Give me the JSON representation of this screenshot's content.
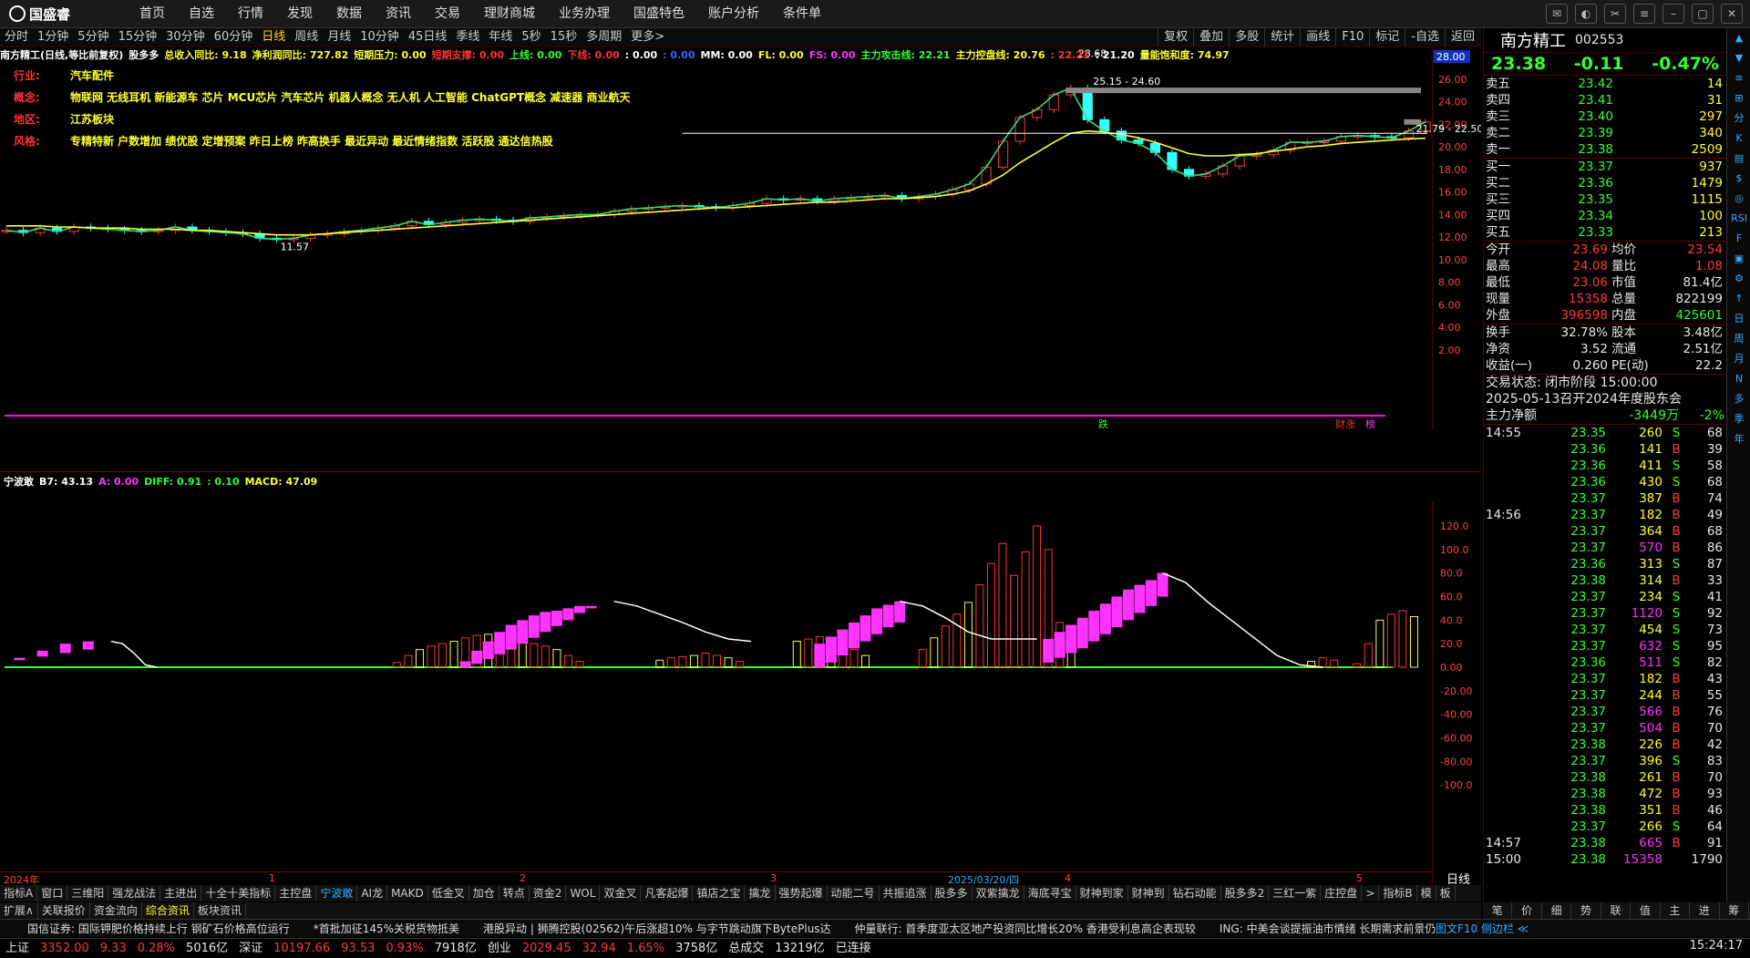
{
  "app": {
    "logo": "国盛睿"
  },
  "menu": [
    "首页",
    "自选",
    "行情",
    "发现",
    "数据",
    "资讯",
    "交易",
    "理财商城",
    "业务办理",
    "国盛特色",
    "账户分析",
    "条件单"
  ],
  "periods": [
    "分时",
    "1分钟",
    "5分钟",
    "15分钟",
    "30分钟",
    "60分钟",
    "日线",
    "周线",
    "月线",
    "10分钟",
    "45日线",
    "季线",
    "年线",
    "5秒",
    "15秒",
    "多周期",
    "更多>"
  ],
  "period_selected": "日线",
  "tools": [
    "复权",
    "叠加",
    "多股",
    "统计",
    "画线",
    "F10",
    "标记",
    "-自选",
    "返回"
  ],
  "indicator_line": [
    {
      "t": "南方精工(日线,等比前复权)",
      "c": "#ffffff"
    },
    {
      "t": "股多多",
      "c": "#ffffff"
    },
    {
      "t": "总收入同比: 9.18",
      "c": "#ffff33"
    },
    {
      "t": "净利润同比: 727.82",
      "c": "#ffff33"
    },
    {
      "t": "短期压力: 0.00",
      "c": "#ffff33"
    },
    {
      "t": "短期支撑: 0.00",
      "c": "#ff3333"
    },
    {
      "t": "上线: 0.00",
      "c": "#33ff33"
    },
    {
      "t": "下线: 0.00",
      "c": "#ff3333"
    },
    {
      "t": ": 0.00",
      "c": "#ffffff"
    },
    {
      "t": ": 0.00",
      "c": "#3366ff"
    },
    {
      "t": "MM: 0.00",
      "c": "#ffffff"
    },
    {
      "t": "FL: 0.00",
      "c": "#ffff33"
    },
    {
      "t": "FS: 0.00",
      "c": "#ff33ff"
    },
    {
      "t": "主力攻击线: 22.21",
      "c": "#33ff33"
    },
    {
      "t": "主力控盘线: 20.76",
      "c": "#ffff33"
    },
    {
      "t": ": 22.21",
      "c": "#ff3333"
    },
    {
      "t": ": 21.20",
      "c": "#ffffff"
    },
    {
      "t": "量能饱和度: 74.97",
      "c": "#ffff33"
    }
  ],
  "tags": [
    {
      "k": "行业:",
      "v": "汽车配件"
    },
    {
      "k": "概念:",
      "v": "物联网 无线耳机 新能源车 芯片 MCU芯片 汽车芯片 机器人概念 无人机 人工智能 ChatGPT概念 减速器 商业航天"
    },
    {
      "k": "地区:",
      "v": "江苏板块"
    },
    {
      "k": "风格:",
      "v": "专精特新 户数增加 绩优股 定增预案 昨日上榜 昨高换手 最近异动 最近情绪指数 活跃股 通达信热股"
    }
  ],
  "chart_labels": {
    "high": "28.68",
    "low": "11.57",
    "range1": "25.15 - 24.60",
    "range2": "21.79 - 22.50",
    "axis_tag": "28.00",
    "fall": "跌",
    "cai": "财涨",
    "bang": "榜"
  },
  "chart_data": [
    {
      "type": "line",
      "title": "南方精工(日线,等比前复权)",
      "xlabel": "",
      "ylabel": "",
      "ylim": [
        2,
        28
      ],
      "yticks": [
        "26.00",
        "24.00",
        "22.00",
        "20.00",
        "18.00",
        "16.00",
        "14.00",
        "12.00",
        "10.00",
        "8.00",
        "6.00",
        "4.00",
        "2.00"
      ],
      "xticks": [
        "2024年",
        "1",
        "2",
        "3",
        "2025/03/20/四",
        "4",
        "5"
      ],
      "series": [
        {
          "name": "主力攻击线",
          "values": [
            12.6,
            12.4,
            12.8,
            12.5,
            12.9,
            12.8,
            12.7,
            12.6,
            12.5,
            12.6,
            12.9,
            12.6,
            12.5,
            12.4,
            12.3,
            11.9,
            11.8,
            11.9,
            12.2,
            12.3,
            12.5,
            12.6,
            12.8,
            13.0,
            13.4,
            13.1,
            13.3,
            13.5,
            13.6,
            13.5,
            13.4,
            13.7,
            13.8,
            13.9,
            14.0,
            14.0,
            14.3,
            14.5,
            14.6,
            14.7,
            14.8,
            14.7,
            14.6,
            14.8,
            15.0,
            15.4,
            15.3,
            15.4,
            15.2,
            15.4,
            15.5,
            15.6,
            15.7,
            15.4,
            15.6,
            15.8,
            16.2,
            16.7,
            18.2,
            20.5,
            22.6,
            23.3,
            24.6,
            25.2,
            22.4,
            21.4,
            20.6,
            20.3,
            19.5,
            18.0,
            17.4,
            17.6,
            18.3,
            19.2,
            19.3,
            19.7,
            20.4,
            20.4,
            20.5,
            20.9,
            21.0,
            20.9,
            20.8,
            21.4,
            22.2
          ]
        },
        {
          "name": "主力控盘线",
          "values": [
            13.0,
            13.0,
            13.0,
            12.9,
            12.9,
            12.8,
            12.8,
            12.8,
            12.7,
            12.7,
            12.7,
            12.6,
            12.6,
            12.5,
            12.4,
            12.3,
            12.2,
            12.2,
            12.2,
            12.3,
            12.4,
            12.5,
            12.6,
            12.7,
            12.8,
            12.9,
            13.0,
            13.1,
            13.2,
            13.3,
            13.4,
            13.5,
            13.6,
            13.7,
            13.8,
            13.9,
            14.0,
            14.1,
            14.2,
            14.3,
            14.4,
            14.5,
            14.6,
            14.6,
            14.7,
            14.8,
            14.9,
            15.0,
            15.1,
            15.1,
            15.2,
            15.3,
            15.4,
            15.4,
            15.5,
            15.6,
            15.8,
            16.1,
            16.7,
            17.5,
            18.6,
            19.5,
            20.4,
            21.2,
            21.4,
            21.3,
            21.1,
            20.8,
            20.4,
            19.9,
            19.4,
            19.2,
            19.2,
            19.3,
            19.4,
            19.6,
            19.8,
            20.0,
            20.1,
            20.3,
            20.4,
            20.5,
            20.6,
            20.7,
            20.76
          ]
        }
      ]
    },
    {
      "type": "bar",
      "title": "宁波敢",
      "legend": [
        {
          "t": "B7: 43.13",
          "c": "#ffffff"
        },
        {
          "t": "A: 0.00",
          "c": "#ff33ff"
        },
        {
          "t": "DIFF: 0.91",
          "c": "#33ff33"
        },
        {
          "t": ": 0.10",
          "c": "#33ff33"
        },
        {
          "t": "MACD: 47.09",
          "c": "#ffff33"
        }
      ],
      "ylim": [
        -120,
        120
      ],
      "yticks": [
        "120.0",
        "100.0",
        "80.0",
        "60.0",
        "40.0",
        "20.0",
        "0.00",
        "-20.00",
        "-40.00",
        "-60.00",
        "-80.00",
        "-100.0"
      ],
      "values": [
        0,
        0,
        0,
        0,
        0,
        0,
        0,
        0,
        0,
        0,
        0,
        0,
        0,
        0,
        0,
        0,
        0,
        0,
        0,
        0,
        0,
        0,
        0,
        0,
        0,
        0,
        0,
        0,
        0,
        0,
        0,
        0,
        0,
        0,
        0,
        0,
        0,
        0,
        0,
        0,
        0,
        0,
        0,
        0,
        0,
        0,
        0,
        0,
        0,
        0,
        0,
        0,
        0,
        0,
        0,
        0,
        0,
        0,
        0,
        0,
        0,
        0,
        0,
        0,
        0,
        0,
        0,
        0,
        0,
        0,
        0,
        0,
        0,
        0,
        0,
        0,
        0,
        0,
        0,
        0,
        0,
        0,
        0,
        0,
        0
      ],
      "bars": [
        {
          "i": 34,
          "v": 4
        },
        {
          "i": 35,
          "v": 10
        },
        {
          "i": 36,
          "v": 15
        },
        {
          "i": 37,
          "v": 18
        },
        {
          "i": 38,
          "v": 20
        },
        {
          "i": 39,
          "v": 22
        },
        {
          "i": 40,
          "v": 25
        },
        {
          "i": 41,
          "v": 27
        },
        {
          "i": 42,
          "v": 28
        },
        {
          "i": 43,
          "v": 29
        },
        {
          "i": 44,
          "v": 28
        },
        {
          "i": 45,
          "v": 24
        },
        {
          "i": 46,
          "v": 20
        },
        {
          "i": 47,
          "v": 18
        },
        {
          "i": 48,
          "v": 15
        },
        {
          "i": 49,
          "v": 10
        },
        {
          "i": 50,
          "v": 5
        },
        {
          "i": 57,
          "v": 6
        },
        {
          "i": 58,
          "v": 8
        },
        {
          "i": 59,
          "v": 9
        },
        {
          "i": 60,
          "v": 10
        },
        {
          "i": 61,
          "v": 12
        },
        {
          "i": 62,
          "v": 10
        },
        {
          "i": 63,
          "v": 8
        },
        {
          "i": 64,
          "v": 5
        },
        {
          "i": 69,
          "v": 22
        },
        {
          "i": 70,
          "v": 24
        },
        {
          "i": 71,
          "v": 26
        },
        {
          "i": 72,
          "v": 25
        },
        {
          "i": 73,
          "v": 20
        },
        {
          "i": 74,
          "v": 15
        },
        {
          "i": 75,
          "v": 10
        },
        {
          "i": 80,
          "v": 15
        },
        {
          "i": 81,
          "v": 25
        },
        {
          "i": 82,
          "v": 35
        },
        {
          "i": 83,
          "v": 45
        },
        {
          "i": 84,
          "v": 55
        },
        {
          "i": 85,
          "v": 70
        },
        {
          "i": 86,
          "v": 88
        },
        {
          "i": 87,
          "v": 105
        },
        {
          "i": 88,
          "v": 78
        },
        {
          "i": 89,
          "v": 98
        },
        {
          "i": 90,
          "v": 120
        },
        {
          "i": 91,
          "v": 100
        },
        {
          "i": 92,
          "v": 38
        },
        {
          "i": 93,
          "v": 15
        },
        {
          "i": 114,
          "v": 5
        },
        {
          "i": 115,
          "v": 8
        },
        {
          "i": 116,
          "v": 6
        },
        {
          "i": 118,
          "v": 3
        },
        {
          "i": 119,
          "v": 20
        },
        {
          "i": 120,
          "v": 40
        },
        {
          "i": 121,
          "v": 45
        },
        {
          "i": 122,
          "v": 48
        },
        {
          "i": 123,
          "v": 43
        }
      ]
    }
  ],
  "quote": {
    "name": "南方精工",
    "code": "002553",
    "price": "23.38",
    "change": "-0.11",
    "pct": "-0.47%",
    "asks": [
      {
        "l": "卖五",
        "p": "23.42",
        "v": "14"
      },
      {
        "l": "卖四",
        "p": "23.41",
        "v": "31"
      },
      {
        "l": "卖三",
        "p": "23.40",
        "v": "297"
      },
      {
        "l": "卖二",
        "p": "23.39",
        "v": "340"
      },
      {
        "l": "卖一",
        "p": "23.38",
        "v": "2509"
      }
    ],
    "bids": [
      {
        "l": "买一",
        "p": "23.37",
        "v": "937"
      },
      {
        "l": "买二",
        "p": "23.36",
        "v": "1479"
      },
      {
        "l": "买三",
        "p": "23.35",
        "v": "1115"
      },
      {
        "l": "买四",
        "p": "23.34",
        "v": "100"
      },
      {
        "l": "买五",
        "p": "23.33",
        "v": "213"
      }
    ],
    "stats": [
      {
        "l1": "今开",
        "v1": "23.69",
        "c1": "red",
        "l2": "均价",
        "v2": "23.54",
        "c2": "red"
      },
      {
        "l1": "最高",
        "v1": "24.08",
        "c1": "red",
        "l2": "量比",
        "v2": "1.08",
        "c2": "red"
      },
      {
        "l1": "最低",
        "v1": "23.06",
        "c1": "red",
        "l2": "市值",
        "v2": "81.4亿",
        "c2": "wht"
      },
      {
        "l1": "现量",
        "v1": "15358",
        "c1": "red",
        "l2": "总量",
        "v2": "822199",
        "c2": "wht"
      },
      {
        "l1": "外盘",
        "v1": "396598",
        "c1": "red",
        "l2": "内盘",
        "v2": "425601",
        "c2": "grn"
      }
    ],
    "stats2": [
      {
        "l1": "换手",
        "v1": "32.78%",
        "l2": "股本",
        "v2": "3.48亿"
      },
      {
        "l1": "净资",
        "v1": "3.52",
        "l2": "流通",
        "v2": "2.51亿"
      },
      {
        "l1": "收益(一)",
        "v1": "0.260",
        "l2": "PE(动)",
        "v2": "22.2"
      }
    ],
    "trade_state": "交易状态: 闭市阶段 15:00:00",
    "notice": "2025-05-13召开2024年度股东会",
    "netflow_label": "主力净额",
    "netflow_val": "-3449万",
    "netflow_pct": "-2%"
  },
  "ticks": [
    {
      "t": "14:55",
      "p": "23.35",
      "v": "260",
      "s": "S",
      "n": "68"
    },
    {
      "t": "",
      "p": "23.36",
      "v": "141",
      "s": "B",
      "n": "39"
    },
    {
      "t": "",
      "p": "23.36",
      "v": "411",
      "s": "S",
      "n": "58"
    },
    {
      "t": "",
      "p": "23.36",
      "v": "430",
      "s": "S",
      "n": "68"
    },
    {
      "t": "",
      "p": "23.37",
      "v": "387",
      "s": "B",
      "n": "74"
    },
    {
      "t": "14:56",
      "p": "23.37",
      "v": "182",
      "s": "B",
      "n": "49"
    },
    {
      "t": "",
      "p": "23.37",
      "v": "364",
      "s": "B",
      "n": "68"
    },
    {
      "t": "",
      "p": "23.37",
      "v": "570",
      "s": "B",
      "n": "86"
    },
    {
      "t": "",
      "p": "23.36",
      "v": "313",
      "s": "S",
      "n": "87"
    },
    {
      "t": "",
      "p": "23.38",
      "v": "314",
      "s": "B",
      "n": "33"
    },
    {
      "t": "",
      "p": "23.37",
      "v": "234",
      "s": "S",
      "n": "41"
    },
    {
      "t": "",
      "p": "23.37",
      "v": "1120",
      "s": "S",
      "n": "92"
    },
    {
      "t": "",
      "p": "23.37",
      "v": "454",
      "s": "S",
      "n": "73"
    },
    {
      "t": "",
      "p": "23.37",
      "v": "632",
      "s": "S",
      "n": "95"
    },
    {
      "t": "",
      "p": "23.36",
      "v": "511",
      "s": "S",
      "n": "82"
    },
    {
      "t": "",
      "p": "23.37",
      "v": "182",
      "s": "B",
      "n": "43"
    },
    {
      "t": "",
      "p": "23.37",
      "v": "244",
      "s": "B",
      "n": "55"
    },
    {
      "t": "",
      "p": "23.37",
      "v": "566",
      "s": "B",
      "n": "76"
    },
    {
      "t": "",
      "p": "23.37",
      "v": "504",
      "s": "B",
      "n": "70"
    },
    {
      "t": "",
      "p": "23.38",
      "v": "226",
      "s": "B",
      "n": "42"
    },
    {
      "t": "",
      "p": "23.37",
      "v": "396",
      "s": "S",
      "n": "83"
    },
    {
      "t": "",
      "p": "23.38",
      "v": "261",
      "s": "B",
      "n": "70"
    },
    {
      "t": "",
      "p": "23.38",
      "v": "472",
      "s": "B",
      "n": "93"
    },
    {
      "t": "",
      "p": "23.38",
      "v": "351",
      "s": "B",
      "n": "46"
    },
    {
      "t": "",
      "p": "23.37",
      "v": "266",
      "s": "S",
      "n": "64"
    },
    {
      "t": "14:57",
      "p": "23.38",
      "v": "665",
      "s": "B",
      "n": "91"
    },
    {
      "t": "15:00",
      "p": "23.38",
      "v": "15358",
      "s": "",
      "n": "1790"
    }
  ],
  "sidebar": [
    "▲",
    "▼",
    "≡",
    "⊞",
    "分",
    "K",
    "▤",
    "$",
    "◎",
    "RSI",
    "F",
    "▣",
    "⚙",
    "↑",
    "日",
    "周",
    "月",
    "N",
    "多",
    "季",
    "年"
  ],
  "tabs1": [
    "指标A",
    "窗口",
    "三维阳",
    "强龙战法",
    "主进出",
    "十全十美指标",
    "主控盘",
    "宁波敢",
    "AI龙",
    "MAKD",
    "低金叉",
    "加仓",
    "转点",
    "资金2",
    "WOL",
    "双金叉",
    "凡客起爆",
    "镇店之宝",
    "擒龙",
    "强势起爆",
    "动能二号",
    "共振追涨",
    "股多多",
    "双紫擒龙",
    "海底寻宝",
    "财神到家",
    "财神到",
    "钻石动能",
    "股多多2",
    "三红一紫",
    "庄控盘",
    ">",
    "指标B",
    "模",
    "板"
  ],
  "tab1_selected": "宁波敢",
  "tabs2": [
    "扩展∧",
    "关联报价",
    "资金流向",
    "综合资讯",
    "板块资讯"
  ],
  "tab2_selected": "综合资讯",
  "rtabs": [
    "笔",
    "价",
    "细",
    "势",
    "联",
    "值",
    "主",
    "进",
    "筹"
  ],
  "news": [
    "国信证券: 国际钾肥价格持续上行  钢矿石价格高位运行",
    "*首批加征145%关税货物抵美",
    "港股异动 | 狮腾控股(02562)午后涨超10% 与字节跳动旗下BytePlus达",
    "仲量联行: 首季度亚太区地产投资同比增长20% 香港受利息高企表现较",
    "ING: 中美会谈提振油市情绪 长期需求前景仍取决于关税实"
  ],
  "news_right": "图文F10  侧边栏 ≪",
  "status": [
    {
      "t": "上证",
      "c": "#e8e8e8"
    },
    {
      "t": "3352.00",
      "c": "#ff3b3b"
    },
    {
      "t": "9.33",
      "c": "#ff3b3b"
    },
    {
      "t": "0.28%",
      "c": "#ff3b3b"
    },
    {
      "t": "5016亿",
      "c": "#e8e8e8"
    },
    {
      "t": "深证",
      "c": "#e8e8e8"
    },
    {
      "t": "10197.66",
      "c": "#ff3b3b"
    },
    {
      "t": "93.53",
      "c": "#ff3b3b"
    },
    {
      "t": "0.93%",
      "c": "#ff3b3b"
    },
    {
      "t": "7918亿",
      "c": "#e8e8e8"
    },
    {
      "t": "创业",
      "c": "#e8e8e8"
    },
    {
      "t": "2029.45",
      "c": "#ff3b3b"
    },
    {
      "t": "32.94",
      "c": "#ff3b3b"
    },
    {
      "t": "1.65%",
      "c": "#ff3b3b"
    },
    {
      "t": "3758亿",
      "c": "#e8e8e8"
    },
    {
      "t": "总成交",
      "c": "#e8e8e8"
    },
    {
      "t": "13219亿",
      "c": "#e8e8e8"
    },
    {
      "t": "已连接",
      "c": "#e8e8e8"
    }
  ],
  "clock": "15:24:17"
}
